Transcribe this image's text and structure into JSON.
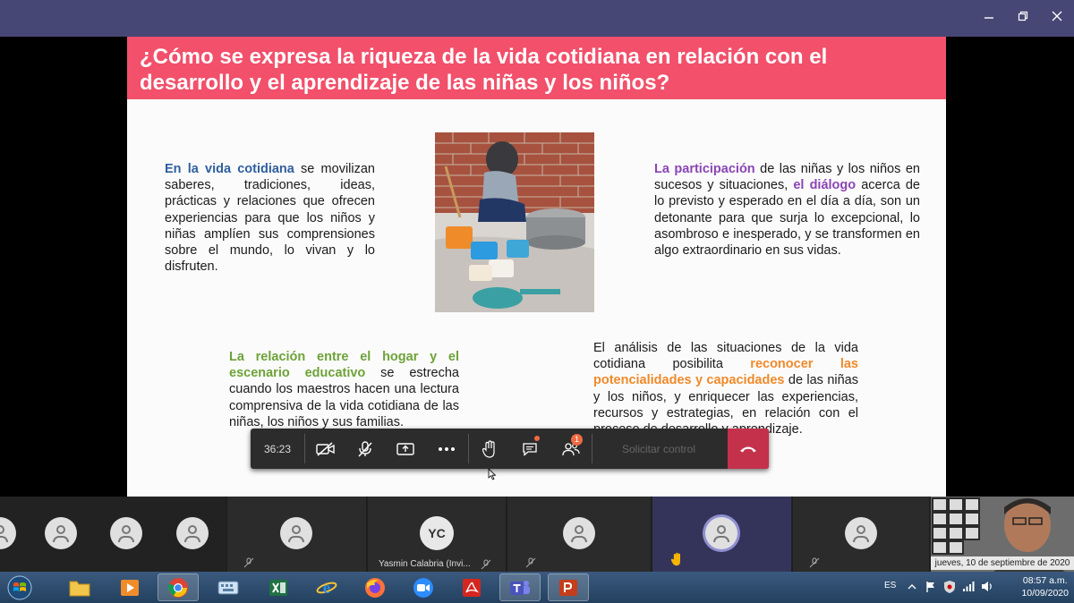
{
  "window": {
    "minimize_icon": "minimize-icon",
    "maximize_icon": "maximize-icon",
    "close_icon": "close-icon"
  },
  "slide": {
    "title": "¿Cómo se expresa la riqueza de la vida cotidiana en relación con el desarrollo y el aprendizaje de las niñas y los niños?",
    "p1_highlight": "En la vida cotidiana",
    "p1_text": " se movilizan saberes, tradiciones, ideas, prácticas y relaciones que ofrecen experiencias para que los niños y niñas amplíen sus comprensiones sobre el mundo, lo vivan y lo disfruten.",
    "p2_highlight1": "La participación",
    "p2_text1": " de las niñas y los niños en sucesos y situaciones, ",
    "p2_highlight2": "el diálogo",
    "p2_text2": " acerca de lo previsto y esperado en el día a día, son un detonante para que surja lo excepcional, lo asombroso e inesperado, y se transformen en algo extraordinario en sus vidas.",
    "p3_highlight": "La relación entre el hogar y el escenario educativo",
    "p3_text": " se estrecha cuando los maestros hacen una lectura comprensiva de la vida cotidiana de las niñas, los niños y sus familias.",
    "p4_text1": "El análisis de las situaciones de la vida cotidiana posibilita ",
    "p4_highlight": "reconocer las potencialidades y capacidades",
    "p4_text2": " de las niñas y los niños, y enriquecer las experiencias, recursos y estrategias, en relación con el proceso de desarrollo y aprendizaje."
  },
  "call_bar": {
    "timer": "36:23",
    "request_control_label": "Solicitar control",
    "chat_badge": "",
    "participants_badge": "1"
  },
  "participants": {
    "yc_initials": "YC",
    "yc_name": "Yasmin Calabria (Invi..."
  },
  "self_view": {
    "date_label": "jueves, 10 de septiembre de 2020"
  },
  "taskbar": {
    "language": "ES",
    "time": "08:57 a.m.",
    "date": "10/09/2020"
  }
}
